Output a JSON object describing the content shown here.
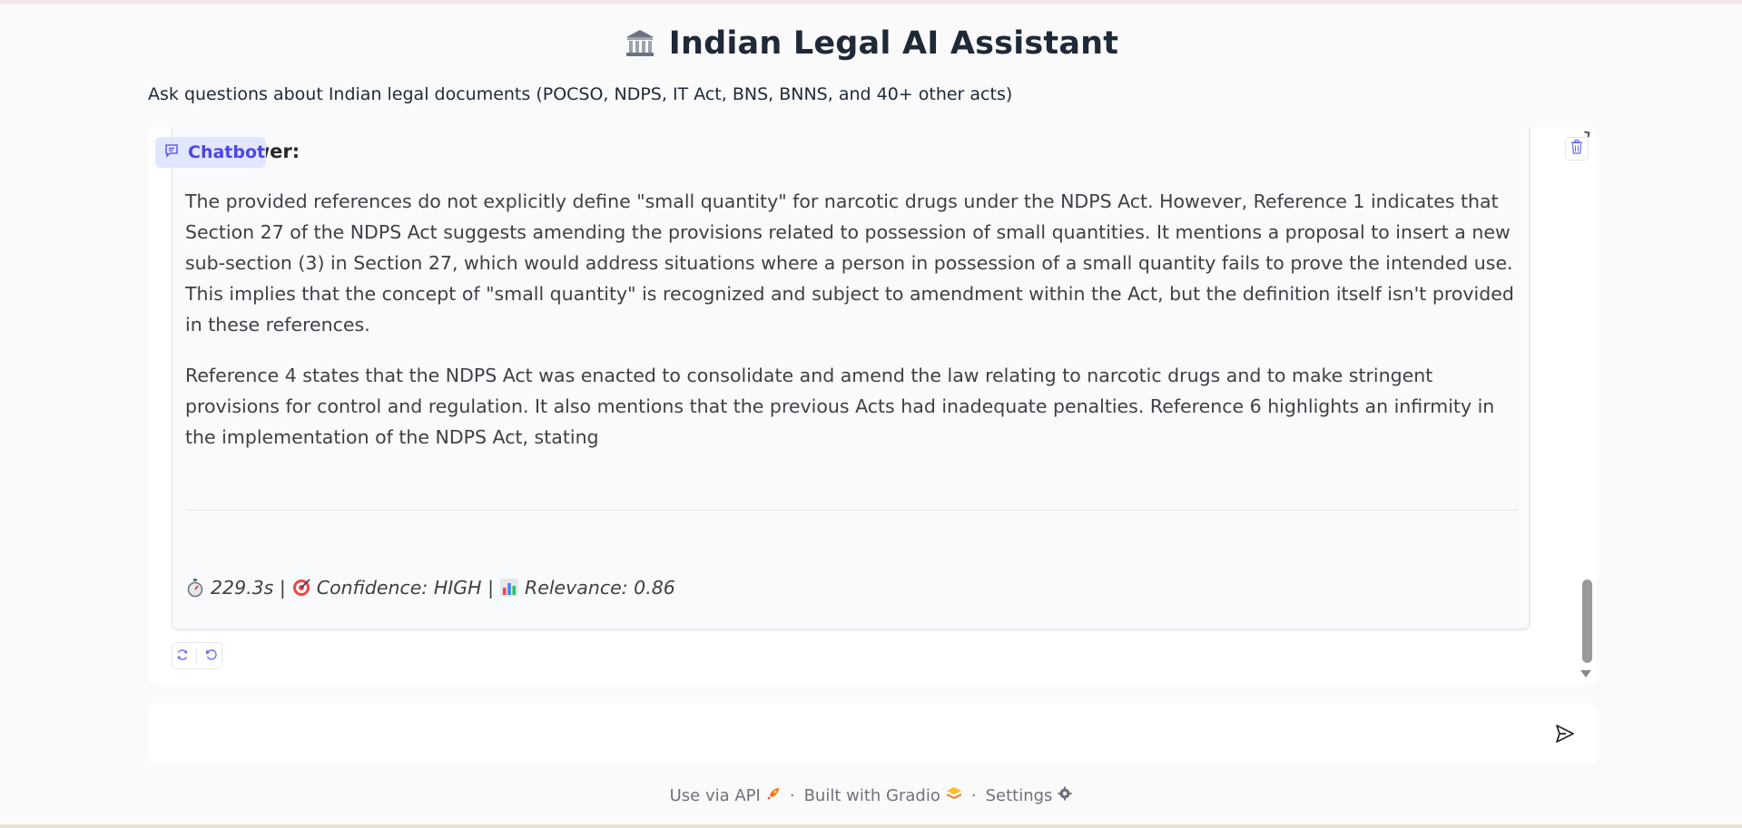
{
  "header": {
    "title": "Indian Legal AI Assistant",
    "title_icon": "classical-building-icon",
    "subtitle": "Ask questions about Indian legal documents (POCSO, NDPS, IT Act, BNS, BNNS, and 40+ other acts)"
  },
  "chatbot": {
    "label": "Chatbot",
    "message": {
      "heading": "Answer:",
      "paragraphs": [
        "The provided references do not explicitly define \"small quantity\" for narcotic drugs under the NDPS Act. However, Reference 1 indicates that Section 27 of the NDPS Act suggests amending the provisions related to possession of small quantities. It mentions a proposal to insert a new sub-section (3) in Section 27, which would address situations where a person in possession of a small quantity fails to prove the intended use. This implies that the concept of \"small quantity\" is recognized and subject to amendment within the Act, but the definition itself isn't provided in these references.",
        "Reference 4 states that the NDPS Act was enacted to consolidate and amend the law relating to narcotic drugs and to make stringent provisions for control and regulation. It also mentions that the previous Acts had inadequate penalties. Reference 6 highlights an infirmity in the implementation of the NDPS Act, stating"
      ],
      "meta": {
        "time": "229.3s |",
        "confidence": "Confidence: HIGH |",
        "relevance": "Relevance: 0.86"
      }
    }
  },
  "input": {
    "placeholder": "",
    "value": ""
  },
  "footer": {
    "api_label": "Use via API",
    "built_label": "Built with Gradio",
    "settings_label": "Settings",
    "separator": "·"
  },
  "colors": {
    "accent": "#4f46e5",
    "badge_bg": "#e0e7ff",
    "background": "#fafafa"
  }
}
